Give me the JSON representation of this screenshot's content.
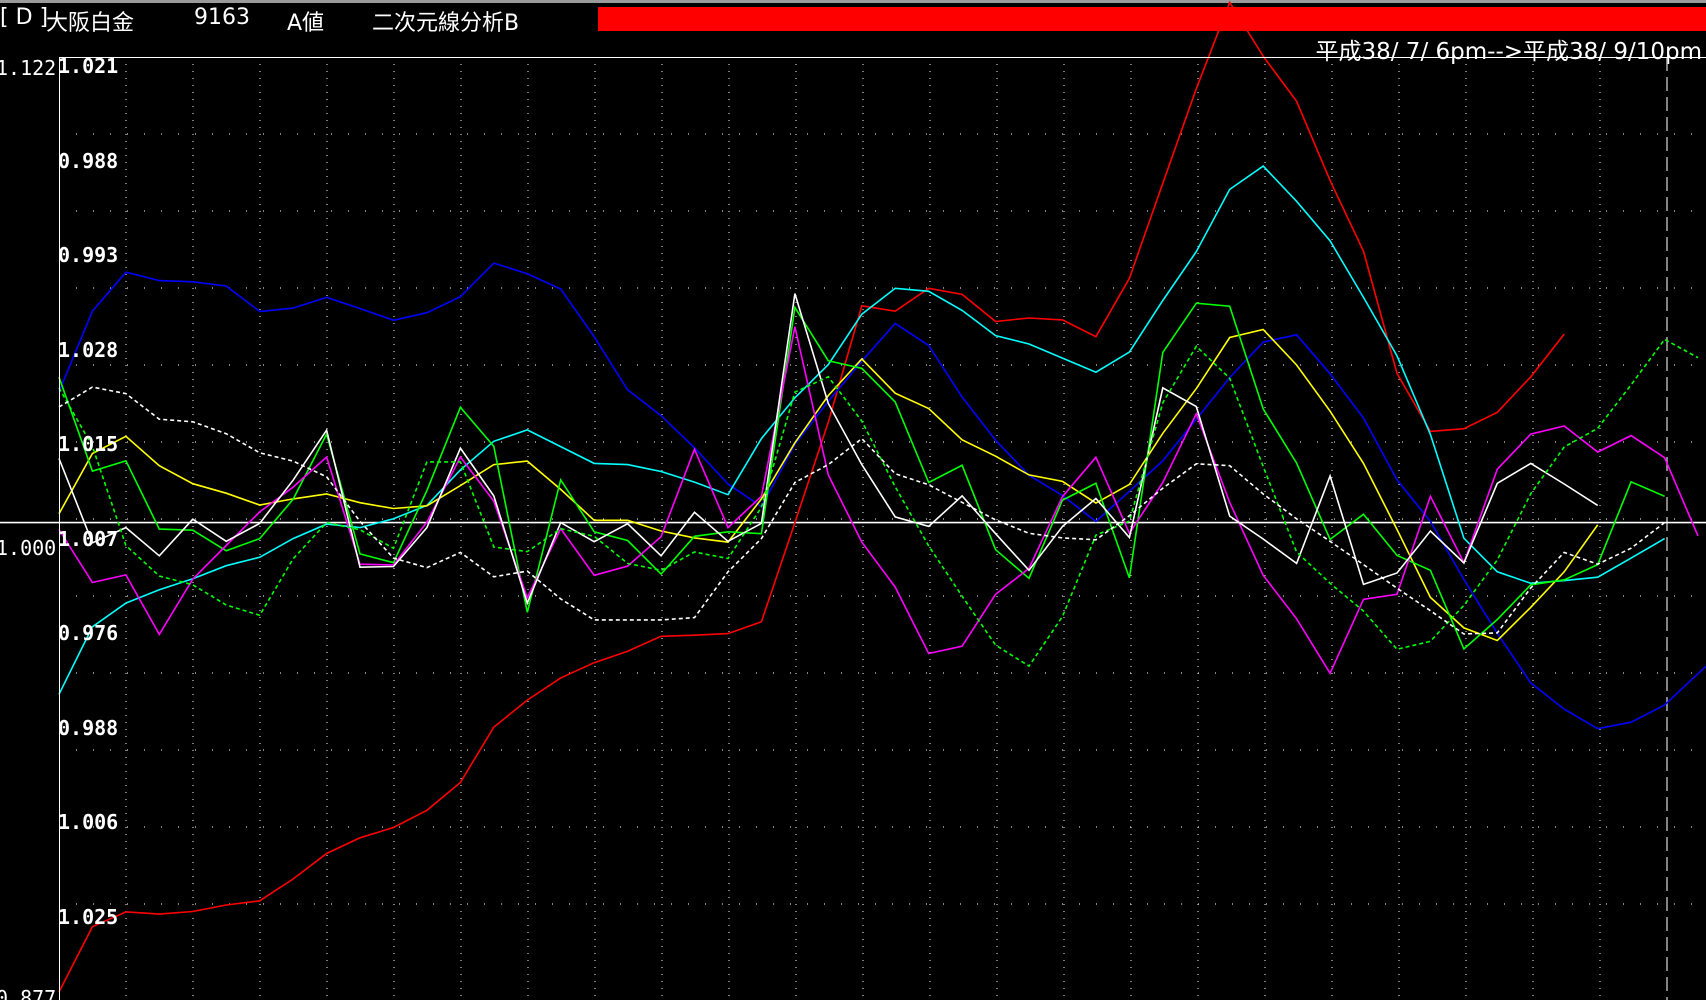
{
  "window": {
    "bracket": "[ D ]",
    "name": "大阪白金",
    "code": "9163",
    "type": "A値",
    "analysis": "二次元線分析B",
    "date_range": "平成38/ 7/ 6pm-->平成38/ 9/10pm",
    "bar_color": "#ff0000"
  },
  "chart_data": {
    "type": "line",
    "title": "",
    "xlabel": "",
    "ylabel": "",
    "ylim": [
      0.877,
      1.122
    ],
    "left_axis_labels": [
      "1.122",
      "1.000",
      "0.877"
    ],
    "inner_axis_labels": [
      "1.021",
      "0.988",
      "0.993",
      "1.028",
      "1.015",
      "1.007",
      "0.976",
      "0.988",
      "1.006",
      "1.025"
    ],
    "baseline": 1.0,
    "grid": true,
    "x_count": 50,
    "series": [
      {
        "color": "#ff0000",
        "dash": false,
        "values": [
          0.877,
          0.8941,
          0.898,
          0.8974,
          0.8981,
          0.8998,
          0.9009,
          0.9066,
          0.9133,
          0.9174,
          0.9201,
          0.9246,
          0.9319,
          0.9464,
          0.9535,
          0.9593,
          0.9633,
          0.9663,
          0.9702,
          0.9705,
          0.9709,
          0.974,
          1.0,
          1.0263,
          1.0568,
          1.0554,
          1.0614,
          1.0598,
          1.0527,
          1.0536,
          1.0531,
          1.0487,
          1.064,
          1.0889,
          1.1137,
          1.1363,
          1.1222,
          1.1104,
          1.0896,
          1.0711,
          1.0391,
          1.0239,
          1.0246,
          1.0289,
          1.0382,
          1.0494
        ]
      },
      {
        "color": "#0000ff",
        "dash": false,
        "values": [
          1.0343,
          1.0554,
          1.0656,
          1.0634,
          1.0631,
          1.062,
          1.0553,
          1.0562,
          1.059,
          1.0561,
          1.053,
          1.055,
          1.0592,
          1.068,
          1.0652,
          1.0612,
          1.0487,
          1.0348,
          1.028,
          1.0196,
          1.0101,
          1.0042,
          1.0205,
          1.0318,
          1.0423,
          1.0522,
          1.0464,
          1.0329,
          1.0216,
          1.0124,
          1.0071,
          1.0003,
          1.0082,
          1.0162,
          1.0271,
          1.038,
          1.0473,
          1.0492,
          1.039,
          1.0274,
          1.0112,
          1.0003,
          0.9851,
          0.971,
          0.958,
          0.9511,
          0.946,
          0.9477,
          0.9522,
          0.9604,
          0.9685
        ]
      },
      {
        "color": "#00ffff",
        "dash": false,
        "values": [
          0.955,
          0.9727,
          0.9789,
          0.9824,
          0.9853,
          0.9887,
          0.9909,
          0.9958,
          0.9996,
          0.9987,
          1.001,
          1.0045,
          1.0138,
          1.0213,
          1.0243,
          1.0199,
          1.0155,
          1.0152,
          1.0134,
          1.0106,
          1.0073,
          1.022,
          1.0327,
          1.0414,
          1.0546,
          1.0614,
          1.0606,
          1.0556,
          1.049,
          1.0468,
          1.0431,
          1.0394,
          1.0447,
          1.0582,
          1.071,
          1.0873,
          1.0934,
          1.0842,
          1.0738,
          1.059,
          1.0437,
          1.0231,
          0.9959,
          0.9871,
          0.9841,
          0.9848,
          0.9857,
          0.9907,
          0.9958
        ]
      },
      {
        "color": "#ffff00",
        "dash": false,
        "values": [
          1.0023,
          1.0181,
          1.0226,
          1.0149,
          1.0102,
          1.0077,
          1.0046,
          1.0062,
          1.0075,
          1.0052,
          1.0037,
          1.0044,
          1.0097,
          1.0152,
          1.0161,
          1.0087,
          1.0006,
          1.0006,
          0.9978,
          0.996,
          0.9949,
          1.0062,
          1.0209,
          1.0333,
          1.0429,
          1.0339,
          1.0299,
          1.0217,
          1.0174,
          1.0125,
          1.0108,
          1.0051,
          1.01,
          1.0234,
          1.0351,
          1.0485,
          1.0506,
          1.0413,
          1.0292,
          1.0155,
          0.9982,
          0.9804,
          0.9724,
          0.9691,
          0.9778,
          0.9871,
          0.9994
        ]
      },
      {
        "color": "#00ff00",
        "dash": false,
        "values": [
          1.0381,
          1.0135,
          1.0162,
          0.9983,
          0.998,
          0.9926,
          0.9958,
          1.0061,
          1.0232,
          0.9918,
          0.9895,
          1.0084,
          1.0302,
          1.02,
          0.9765,
          1.0112,
          0.9976,
          0.9953,
          0.9865,
          0.9964,
          0.9976,
          0.9971,
          1.0564,
          1.0424,
          1.0404,
          1.0316,
          1.0105,
          1.015,
          0.9929,
          0.9854,
          1.0059,
          1.0103,
          0.9855,
          1.0446,
          1.0575,
          1.0567,
          1.0298,
          1.0156,
          0.9956,
          1.0022,
          0.9914,
          0.9875,
          0.9669,
          0.9746,
          0.9837,
          0.985,
          0.989,
          1.0107,
          1.0069
        ]
      },
      {
        "color": "#ff00ff",
        "dash": false,
        "values": [
          0.9982,
          0.9843,
          0.9863,
          0.9707,
          0.9852,
          0.994,
          1.0028,
          1.0093,
          1.0172,
          0.9891,
          0.9889,
          1.0001,
          1.0172,
          1.0056,
          0.9803,
          0.9984,
          0.9862,
          0.9886,
          0.9963,
          1.0192,
          0.9987,
          1.0069,
          1.0513,
          1.0125,
          0.9949,
          0.9831,
          0.9657,
          0.9676,
          0.9812,
          0.988,
          1.0068,
          1.0171,
          0.9972,
          1.0105,
          1.0285,
          1.0053,
          0.9862,
          0.9748,
          0.9605,
          0.9799,
          0.9812,
          1.0069,
          0.9895,
          1.014,
          1.0232,
          1.0253,
          1.0185,
          1.0228,
          1.017,
          0.9965
        ]
      },
      {
        "color": "#ffffff",
        "dash": false,
        "values": [
          1.0168,
          0.9947,
          0.9987,
          0.9913,
          1.0009,
          0.9951,
          0.9998,
          1.0111,
          1.0242,
          0.9883,
          0.9885,
          0.9987,
          1.0195,
          1.007,
          0.9789,
          1.0,
          0.995,
          0.9997,
          0.9913,
          1.0027,
          0.9951,
          0.9998,
          1.06,
          1.0312,
          1.0152,
          1.0015,
          0.999,
          1.007,
          0.9971,
          0.9875,
          0.999,
          1.0063,
          0.9961,
          1.0353,
          1.0304,
          1.0017,
          0.9957,
          0.9893,
          1.0122,
          0.9838,
          0.9868,
          0.9978,
          0.9894,
          1.0103,
          1.0155,
          1.0101,
          1.0045
        ]
      },
      {
        "color": "#00ff00",
        "dash": true,
        "values": [
          1.0353,
          1.02,
          0.994,
          0.986,
          0.9837,
          0.9784,
          0.9757,
          0.9905,
          1.0,
          0.9981,
          0.9933,
          1.0159,
          1.0159,
          0.9936,
          0.9924,
          0.9984,
          0.9964,
          0.9893,
          0.9875,
          0.9923,
          0.9906,
          1.004,
          1.0342,
          1.0382,
          1.0266,
          1.0094,
          0.9939,
          0.9807,
          0.9679,
          0.9624,
          0.9754,
          0.9967,
          1.0004,
          1.0314,
          1.0462,
          1.0378,
          1.0147,
          0.9923,
          0.9841,
          0.9768,
          0.9668,
          0.9689,
          0.9783,
          0.9902,
          1.0076,
          1.0198,
          1.0247,
          1.0361,
          1.048,
          1.0432
        ]
      },
      {
        "color": "#ffffff",
        "dash": true,
        "values": [
          1.0303,
          1.0355,
          1.0338,
          1.0271,
          1.0264,
          1.0233,
          1.0183,
          1.0161,
          1.012,
          1.0003,
          0.9907,
          0.9882,
          0.9922,
          0.9858,
          0.9873,
          0.98,
          0.9745,
          0.9745,
          0.9745,
          0.9751,
          0.9871,
          0.9958,
          1.0105,
          1.0152,
          1.022,
          1.0128,
          1.0099,
          1.0053,
          1.0007,
          0.9972,
          0.996,
          0.9955,
          1.0018,
          1.009,
          1.0154,
          1.0149,
          1.0075,
          1.001,
          0.9951,
          0.989,
          0.9828,
          0.9769,
          0.9708,
          0.9711,
          0.9829,
          0.9922,
          0.9891,
          0.9933,
          1.0
        ]
      }
    ]
  }
}
